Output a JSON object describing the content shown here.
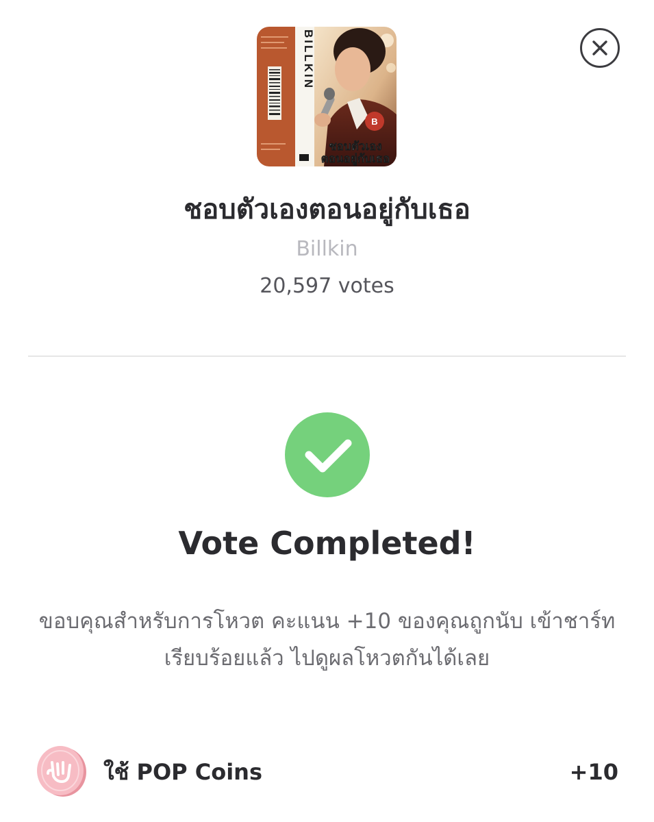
{
  "header": {
    "close_icon": "close-circle-icon"
  },
  "song": {
    "cover_text_artist": "BILLKIN",
    "cover_text_title_line1": "ชอบตัวเอง",
    "cover_text_title_line2": "ตอนอยู่กับเธอ",
    "title": "ชอบตัวเองตอนอยู่กับเธอ",
    "artist": "Billkin",
    "votes_count": "20,597",
    "votes_label": "votes"
  },
  "result": {
    "icon": "checkmark-circle-icon",
    "heading": "Vote Completed!",
    "message_line1": "ขอบคุณสำหรับการโหวต คะแนน +10 ของคุณถูกนับ เข้าชาร์ท",
    "message_line2": "เรียบร้อยแล้ว ไปดูผลโหวตกันได้เลย"
  },
  "coins": {
    "icon": "pop-coin-icon",
    "label": "ใช้ POP Coins",
    "value": "+10"
  },
  "colors": {
    "success_green": "#75d17c",
    "coin_pink": "#f6b7bf",
    "cover_orange": "#b8562e",
    "text_primary": "#2b2b2f",
    "text_muted": "#b8b8be"
  }
}
